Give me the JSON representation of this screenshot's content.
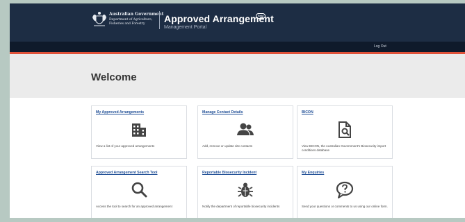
{
  "header": {
    "gov_line1": "Australian Government",
    "gov_line2": "Department of Agriculture,",
    "gov_line3": "Fisheries and Forestry",
    "app_title": "Approved Arrangement",
    "beta_badge": "Beta",
    "app_subtitle": "Management Portal"
  },
  "nav": {
    "logout": "Log Out"
  },
  "main": {
    "heading": "Welcome"
  },
  "cards": [
    {
      "title": "My Approved Arrangements",
      "icon": "building-icon",
      "desc": "View a list of your approved arrangements"
    },
    {
      "title": "Manage Contact Details",
      "icon": "users-icon",
      "desc": "Add, remove or update site contacts"
    },
    {
      "title": "BICON",
      "icon": "document-search-icon",
      "desc": "View BICON, the Australian Government's Biosecurity import conditions database"
    },
    {
      "title": "Approved Arrangement Search Tool",
      "icon": "search-icon",
      "desc": "Access the tool to search for an approved arrangement"
    },
    {
      "title": "Reportable Biosecurity Incident",
      "icon": "bug-icon",
      "desc": "Notify the department of reportable biosecurity incidents"
    },
    {
      "title": "My Enquiries",
      "icon": "question-bubble-icon",
      "desc": "Send your questions or comments to us using our online form."
    }
  ],
  "colors": {
    "header_bg": "#1d2d44",
    "nav_bg": "#0f1a2b",
    "accent": "#e0523a",
    "link": "#1f4e96",
    "icon": "#444444"
  }
}
